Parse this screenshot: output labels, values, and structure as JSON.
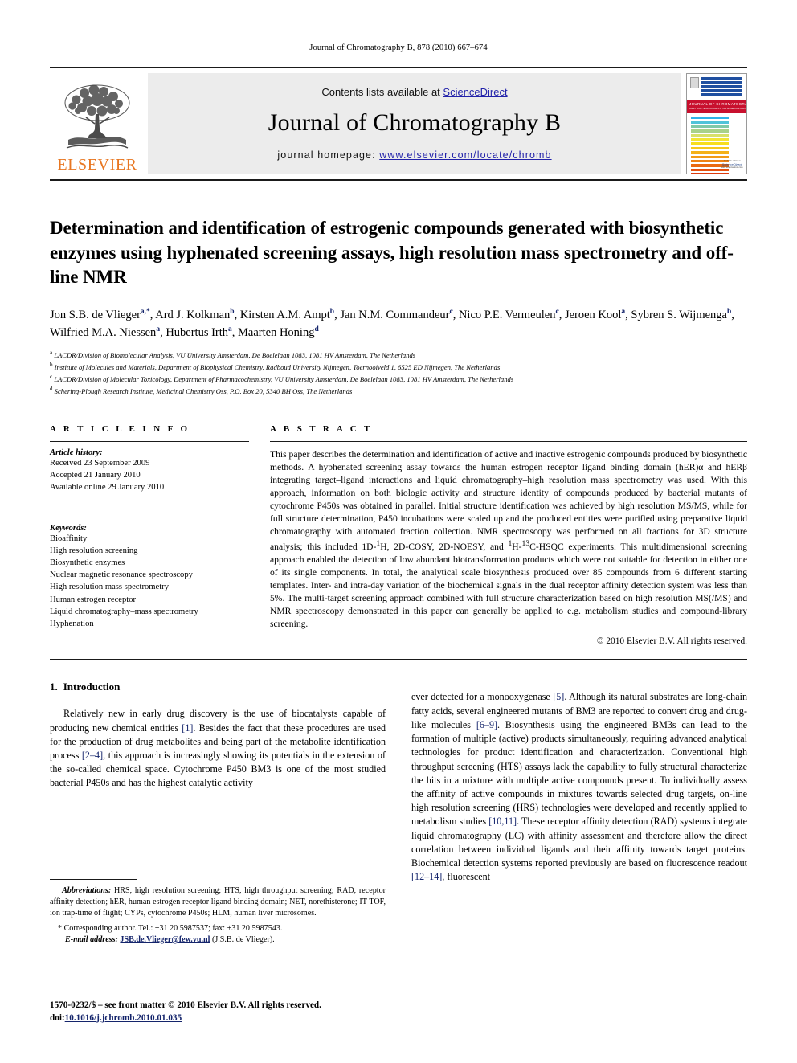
{
  "running_head": "Journal of Chromatography B, 878 (2010) 667–674",
  "masthead": {
    "contents_prefix": "Contents lists available at ",
    "sciencedirect": "ScienceDirect",
    "journal_title": "Journal of Chromatography B",
    "homepage_prefix": "journal homepage: ",
    "homepage_url": "www.elsevier.com/locate/chromb",
    "publisher": "ELSEVIER",
    "cover": {
      "band_title": "JOURNAL OF CHROMATOGRAPHY B",
      "band_subtitle": "ANALYTICAL TECHNOLOGIES IN THE BIOMEDICAL AND LIFE SCIENCES",
      "footer_top": "Available online at",
      "footer_brand": "ScienceDirect",
      "footer_bottom": "www.sciencedirect.com"
    }
  },
  "article": {
    "title": "Determination and identification of estrogenic compounds generated with biosynthetic enzymes using hyphenated screening assays, high resolution mass spectrometry and off-line NMR",
    "authors_html": "Jon S.B. de Vlieger<sup class=\"aff\">a,*</sup>, Ard J. Kolkman<sup class=\"aff\">b</sup>, Kirsten A.M. Ampt<sup class=\"aff\">b</sup>, Jan N.M. Commandeur<sup class=\"aff\">c</sup>, Nico P.E. Vermeulen<sup class=\"aff\">c</sup>, Jeroen Kool<sup class=\"aff\">a</sup>, Sybren S. Wijmenga<sup class=\"aff\">b</sup>, Wilfried M.A. Niessen<sup class=\"aff\">a</sup>, Hubertus Irth<sup class=\"aff\">a</sup>, Maarten Honing<sup class=\"aff\">d</sup>",
    "affiliations": [
      {
        "mark": "a",
        "text": "LACDR/Division of Biomolecular Analysis, VU University Amsterdam, De Boelelaan 1083, 1081 HV Amsterdam, The Netherlands"
      },
      {
        "mark": "b",
        "text": "Institute of Molecules and Materials, Department of Biophysical Chemistry, Radboud University Nijmegen, Toernooiveld 1, 6525 ED Nijmegen, The Netherlands"
      },
      {
        "mark": "c",
        "text": "LACDR/Division of Molecular Toxicology, Department of Pharmacochemistry, VU University Amsterdam, De Boelelaan 1083, 1081 HV Amsterdam, The Netherlands"
      },
      {
        "mark": "d",
        "text": "Schering-Plough Research Institute, Medicinal Chemistry Oss, P.O. Box 20, 5340 BH Oss, The Netherlands"
      }
    ]
  },
  "article_info": {
    "heading": "A R T I C L E    I N F O",
    "history_label": "Article history:",
    "history": [
      "Received 23 September 2009",
      "Accepted 21 January 2010",
      "Available online 29 January 2010"
    ],
    "keywords_label": "Keywords:",
    "keywords": [
      "Bioaffinity",
      "High resolution screening",
      "Biosynthetic enzymes",
      "Nuclear magnetic resonance spectroscopy",
      "High resolution mass spectrometry",
      "Human estrogen receptor",
      "Liquid chromatography–mass spectrometry",
      "Hyphenation"
    ]
  },
  "abstract": {
    "heading": "A B S T R A C T",
    "body_html": "This paper describes the determination and identification of active and inactive estrogenic compounds produced by biosynthetic methods. A hyphenated screening assay towards the human estrogen receptor ligand binding domain (hER)&alpha; and hER&beta; integrating target&ndash;ligand interactions and liquid chromatography&ndash;high resolution mass spectrometry was used. With this approach, information on both biologic activity and structure identity of compounds produced by bacterial mutants of cytochrome P450s was obtained in parallel. Initial structure identification was achieved by high resolution MS/MS, while for full structure determination, P450 incubations were scaled up and the produced entities were purified using preparative liquid chromatography with automated fraction collection. NMR spectroscopy was performed on all fractions for 3D structure analysis; this included 1D-<sup>1</sup>H, 2D-COSY, 2D-NOESY, and <sup>1</sup>H-<sup>13</sup>C-HSQC experiments. This multidimensional screening approach enabled the detection of low abundant biotransformation products which were not suitable for detection in either one of its single components. In total, the analytical scale biosynthesis produced over 85 compounds from 6 different starting templates. Inter- and intra-day variation of the biochemical signals in the dual receptor affinity detection system was less than 5%. The multi-target screening approach combined with full structure characterization based on high resolution MS(/MS) and NMR spectroscopy demonstrated in this paper can generally be applied to e.g. metabolism studies and compound-library screening.",
    "copyright": "© 2010 Elsevier B.V. All rights reserved."
  },
  "introduction": {
    "number": "1.",
    "heading": "Introduction",
    "left_paragraph_html": "Relatively new in early drug discovery is the use of biocatalysts capable of producing new chemical entities <span class=\"ref\">[1]</span>. Besides the fact that these procedures are used for the production of drug metabolites and being part of the metabolite identification process <span class=\"ref\">[2&ndash;4]</span>, this approach is increasingly showing its potentials in the extension of the so-called chemical space. Cytochrome P450 BM3 is one of the most studied bacterial P450s and has the highest catalytic activity",
    "right_paragraph_html": "ever detected for a monooxygenase <span class=\"ref\">[5]</span>. Although its natural substrates are long-chain fatty acids, several engineered mutants of BM3 are reported to convert drug and drug-like molecules <span class=\"ref\">[6&ndash;9]</span>. Biosynthesis using the engineered BM3s can lead to the formation of multiple (active) products simultaneously, requiring advanced analytical technologies for product identification and characterization. Conventional high throughput screening (HTS) assays lack the capability to fully structural characterize the hits in a mixture with multiple active compounds present. To individually assess the affinity of active compounds in mixtures towards selected drug targets, on-line high resolution screening (HRS) technologies were developed and recently applied to metabolism studies <span class=\"ref\">[10,11]</span>. These receptor affinity detection (RAD) systems integrate liquid chromatography (LC) with affinity assessment and therefore allow the direct correlation between individual ligands and their affinity towards target proteins. Biochemical detection systems reported previously are based on fluorescence readout <span class=\"ref\">[12&ndash;14]</span>, fluorescent"
  },
  "footnotes": {
    "abbrev_label": "Abbreviations:",
    "abbrev_text": " HRS, high resolution screening; HTS, high throughput screening; RAD, receptor affinity detection; hER, human estrogen receptor ligand binding domain; NET, norethisterone; IT-TOF, ion trap-time of flight; CYPs, cytochrome P450s; HLM, human liver microsomes.",
    "corresponding": "* Corresponding author. Tel.: +31 20 5987537; fax: +31 20 5987543.",
    "email_label": "E-mail address:",
    "email": "JSB.de.Vlieger@few.vu.nl",
    "email_suffix": " (J.S.B. de Vlieger)."
  },
  "bottom": {
    "front_matter": "1570-0232/$ – see front matter © 2010 Elsevier B.V. All rights reserved.",
    "doi_label": "doi:",
    "doi": "10.1016/j.jchromb.2010.01.035"
  },
  "colors": {
    "link": "#14246b",
    "elsevier_orange": "#E87722",
    "cover_red": "#c8102e",
    "band_grey": "#ececec"
  }
}
